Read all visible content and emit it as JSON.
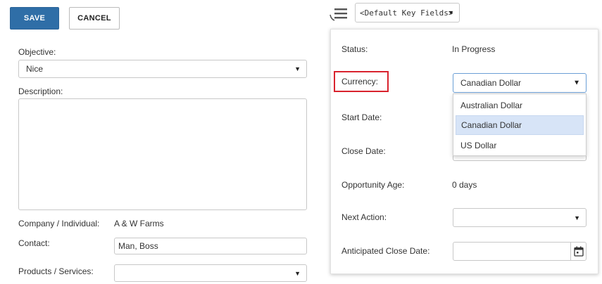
{
  "toolbar": {
    "save_label": "SAVE",
    "cancel_label": "CANCEL"
  },
  "left": {
    "objective_label": "Objective:",
    "objective_value": "Nice",
    "description_label": "Description:",
    "description_value": "",
    "company_label": "Company / Individual:",
    "company_value": "A & W Farms",
    "contact_label": "Contact:",
    "contact_value": "Man, Boss",
    "products_label": "Products / Services:",
    "products_value": ""
  },
  "keyfields": {
    "selected": "<Default Key Fields>"
  },
  "panel": {
    "status_label": "Status:",
    "status_value": "In Progress",
    "currency_label": "Currency:",
    "currency_value": "Canadian Dollar",
    "currency_options": [
      "Australian Dollar",
      "Canadian Dollar",
      "US Dollar"
    ],
    "start_date_label": "Start Date:",
    "close_date_label": "Close Date:",
    "age_label": "Opportunity Age:",
    "age_value": "0 days",
    "next_action_label": "Next Action:",
    "next_action_value": "",
    "anticipated_label": "Anticipated Close Date:",
    "anticipated_value": ""
  },
  "colors": {
    "primary": "#2f6ea7",
    "highlight": "#d9232e",
    "selected_option": "#d7e4f7"
  },
  "icons": {
    "menu": "hamburger-menu-icon",
    "dropdown": "caret-down-icon",
    "calendar": "calendar-icon"
  }
}
